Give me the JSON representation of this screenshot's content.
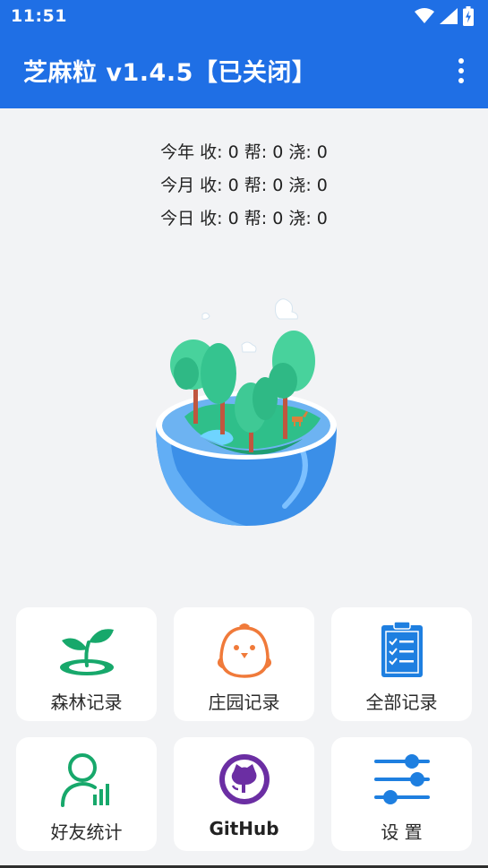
{
  "status_bar": {
    "time": "11:51",
    "icons": [
      "wifi-icon",
      "signal-icon",
      "battery-charging-icon"
    ]
  },
  "app_bar": {
    "title": "芝麻粒 v1.4.5【已关闭】",
    "menu_icon": "more-vert-icon"
  },
  "stats": {
    "year": "今年  收: 0 帮: 0 浇: 0",
    "month": "今月  收: 0 帮: 0 浇: 0",
    "day": "今日  收: 0 帮: 0 浇: 0"
  },
  "illustration": "forest-bowl-illustration",
  "tiles": [
    {
      "label": "森林记录",
      "icon": "sprout-icon"
    },
    {
      "label": "庄园记录",
      "icon": "chick-icon"
    },
    {
      "label": "全部记录",
      "icon": "clipboard-list-icon"
    },
    {
      "label": "好友统计",
      "icon": "user-stats-icon"
    },
    {
      "label": "GitHub",
      "icon": "github-icon"
    },
    {
      "label": "设 置",
      "icon": "sliders-icon"
    }
  ],
  "colors": {
    "primary": "#1f6fe5",
    "background": "#f2f3f5",
    "green": "#17a86b",
    "orange": "#f07a3a",
    "blue": "#1e7fe0",
    "purple": "#6b2ea3"
  }
}
